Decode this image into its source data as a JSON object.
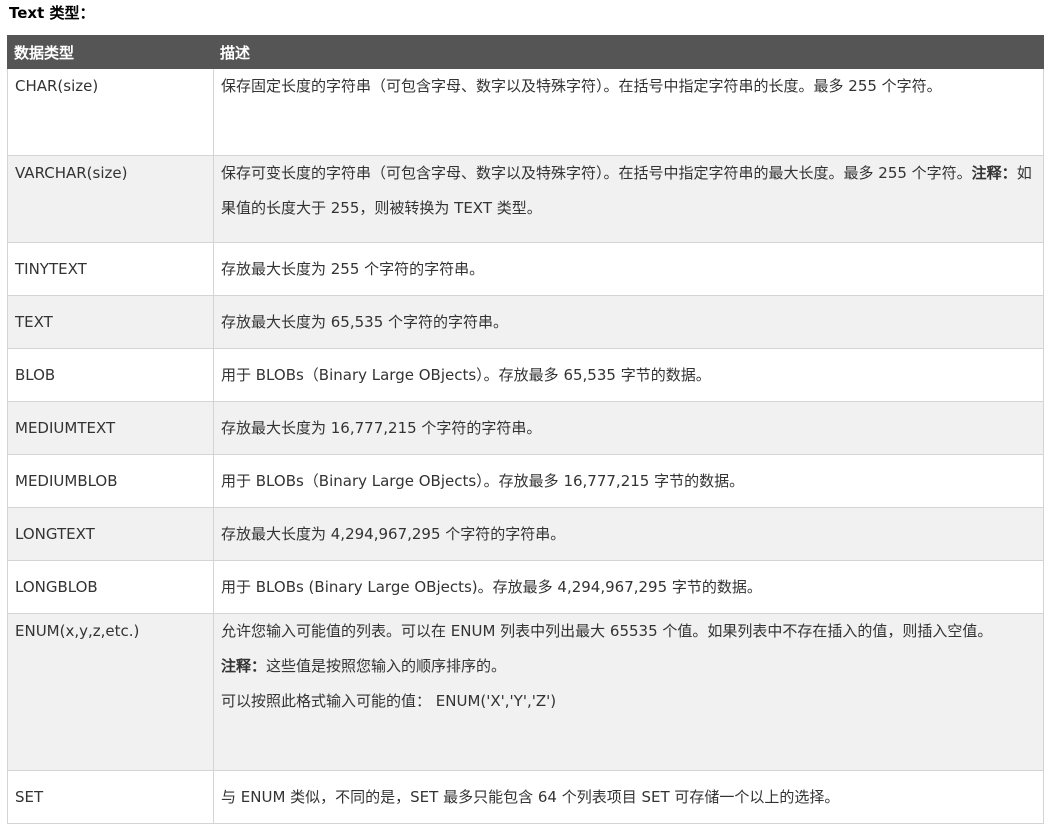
{
  "section_title": "Text 类型：",
  "table": {
    "headers": [
      "数据类型",
      "描述"
    ],
    "rows": [
      {
        "type": "CHAR(size)",
        "desc": "保存固定长度的字符串（可包含字母、数字以及特殊字符）。在括号中指定字符串的长度。最多 255 个字符。"
      },
      {
        "type": "VARCHAR(size)",
        "desc": "保存可变长度的字符串（可包含字母、数字以及特殊字符）。在括号中指定字符串的最大长度。最多 255 个字符。",
        "note_label": "注释：",
        "note_text": "如果值的长度大于 255，则被转换为 TEXT 类型。"
      },
      {
        "type": "TINYTEXT",
        "desc": "存放最大长度为 255 个字符的字符串。"
      },
      {
        "type": "TEXT",
        "desc": "存放最大长度为 65,535 个字符的字符串。"
      },
      {
        "type": "BLOB",
        "desc": "用于 BLOBs（Binary Large OBjects）。存放最多 65,535 字节的数据。"
      },
      {
        "type": "MEDIUMTEXT",
        "desc": "存放最大长度为 16,777,215 个字符的字符串。"
      },
      {
        "type": "MEDIUMBLOB",
        "desc": "用于 BLOBs（Binary Large OBjects）。存放最多 16,777,215 字节的数据。"
      },
      {
        "type": "LONGTEXT",
        "desc": "存放最大长度为 4,294,967,295 个字符的字符串。"
      },
      {
        "type": "LONGBLOB",
        "desc": "用于 BLOBs (Binary Large OBjects)。存放最多 4,294,967,295 字节的数据。"
      },
      {
        "type": "ENUM(x,y,z,etc.)",
        "desc": "允许您输入可能值的列表。可以在 ENUM 列表中列出最大 65535 个值。如果列表中不存在插入的值，则插入空值。",
        "note_label": "注释：",
        "note_text": "这些值是按照您输入的顺序排序的。",
        "extra": "可以按照此格式输入可能的值： ENUM('X','Y','Z')"
      },
      {
        "type": "SET",
        "desc": "与 ENUM 类似，不同的是，SET 最多只能包含 64 个列表项目 SET 可存储一个以上的选择。"
      }
    ]
  }
}
